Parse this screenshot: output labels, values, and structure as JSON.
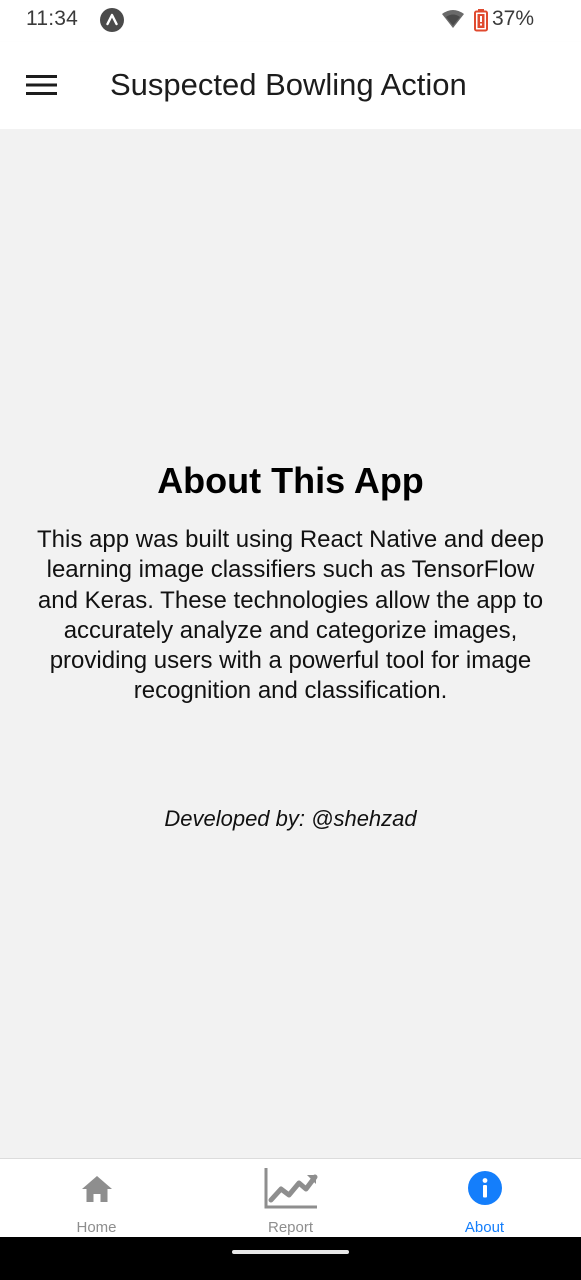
{
  "status_bar": {
    "time": "11:34",
    "battery_percent": "37%",
    "app_icon": "arrow-up-app-icon",
    "wifi_icon": "wifi-icon",
    "battery_icon": "battery-icon"
  },
  "header": {
    "title": "Suspected Bowling Action",
    "menu_icon": "hamburger-menu-icon"
  },
  "about": {
    "heading": "About This App",
    "body": "This app was built using React Native and deep learning image classifiers such as TensorFlow and Keras. These technologies allow the app to accurately analyze and categorize images, providing users with a powerful tool for image recognition and classification.",
    "credit": "Developed by: @shehzad"
  },
  "tabs": [
    {
      "label": "Home",
      "icon": "home-icon",
      "active": false
    },
    {
      "label": "Report",
      "icon": "chart-icon",
      "active": false
    },
    {
      "label": "About",
      "icon": "info-icon",
      "active": true
    }
  ],
  "colors": {
    "active_tab": "#147efb",
    "inactive_tab": "#8e8e8e",
    "content_background": "#f2f2f2",
    "header_background": "#ffffff"
  }
}
